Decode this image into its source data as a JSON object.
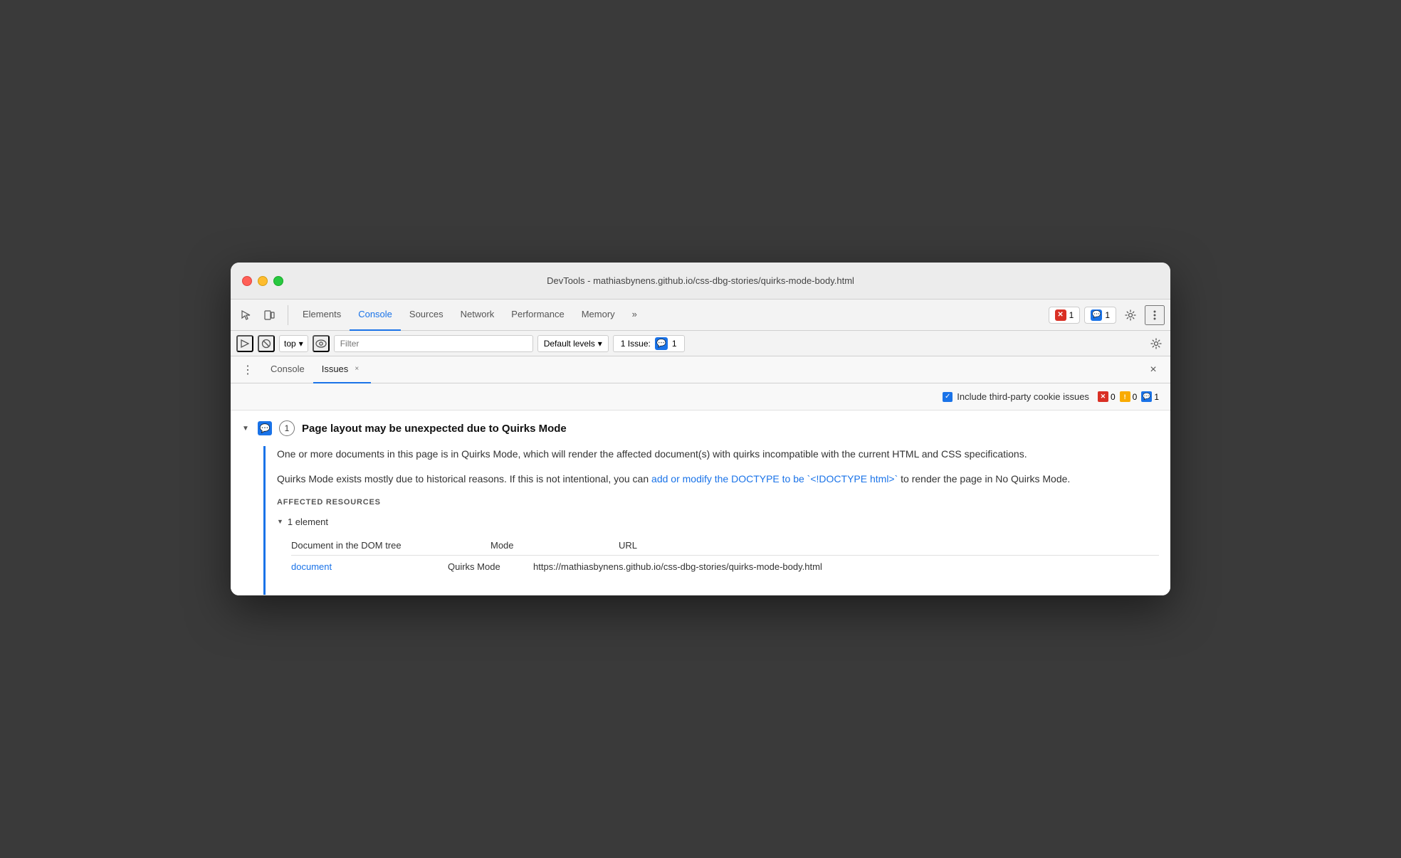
{
  "window": {
    "title": "DevTools - mathiasbynens.github.io/css-dbg-stories/quirks-mode-body.html"
  },
  "toolbar": {
    "tabs": [
      {
        "label": "Elements",
        "active": false
      },
      {
        "label": "Console",
        "active": true
      },
      {
        "label": "Sources",
        "active": false
      },
      {
        "label": "Network",
        "active": false
      },
      {
        "label": "Performance",
        "active": false
      },
      {
        "label": "Memory",
        "active": false
      }
    ],
    "more_label": "»",
    "error_count": "1",
    "message_count": "1",
    "settings_label": "⚙"
  },
  "console_toolbar": {
    "top_label": "top",
    "filter_placeholder": "Filter",
    "default_levels_label": "Default levels",
    "issues_label": "1 Issue:",
    "issues_count": "1"
  },
  "panel": {
    "three_dots": "⋮",
    "tabs": [
      {
        "label": "Console",
        "closeable": false,
        "active": false
      },
      {
        "label": "Issues",
        "closeable": true,
        "active": true
      }
    ],
    "close_label": "×"
  },
  "issues_header": {
    "checkbox_label": "Include third-party cookie issues",
    "error_count": "0",
    "warning_count": "0",
    "info_count": "1"
  },
  "issue": {
    "title": "Page layout may be unexpected due to Quirks Mode",
    "count": "1",
    "description_1": "One or more documents in this page is in Quirks Mode, which will render the affected document(s) with quirks incompatible with the current HTML and CSS specifications.",
    "description_2_pre": "Quirks Mode exists mostly due to historical reasons. If this is not intentional, you can ",
    "description_2_link": "add or modify the DOCTYPE to be `<!DOCTYPE html>`",
    "description_2_post": " to render the page in No Quirks Mode.",
    "affected_label": "AFFECTED RESOURCES",
    "element_count": "1 element",
    "col_doc": "Document in the DOM tree",
    "col_mode": "Mode",
    "col_url": "URL",
    "row_link": "document",
    "row_mode": "Quirks Mode",
    "row_url": "https://mathiasbynens.github.io/css-dbg-stories/quirks-mode-body.html"
  }
}
